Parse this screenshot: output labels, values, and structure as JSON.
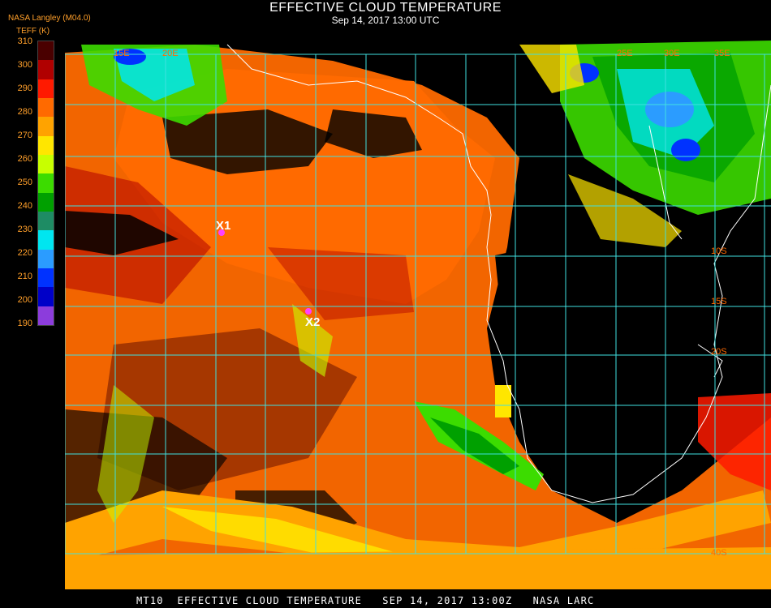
{
  "header": {
    "title": "EFFECTIVE CLOUD TEMPERATURE",
    "subtitle": "Sep 14, 2017 13:00 UTC",
    "org": "NASA Langley (M04.0)",
    "units": "TEFF (K)"
  },
  "legend": {
    "ticks": [
      "310",
      "300",
      "290",
      "280",
      "270",
      "260",
      "250",
      "240",
      "230",
      "220",
      "210",
      "200",
      "190"
    ],
    "colors": [
      "#4a0000",
      "#b00000",
      "#ff1a00",
      "#ff6a00",
      "#ffa300",
      "#ffe600",
      "#c8ff00",
      "#3cdc00",
      "#00a000",
      "#1e8c64",
      "#00e6f0",
      "#2b9cff",
      "#0032ff",
      "#0000c8",
      "#8c3cdc"
    ]
  },
  "map": {
    "grid_color": "#40e0e0",
    "coast_color": "#ffffff",
    "lat_labels": [
      "10S",
      "15S",
      "20S",
      "40S"
    ],
    "lon_labels": [
      "15E",
      "20E",
      "25E",
      "30E",
      "35E"
    ],
    "markers": [
      {
        "label": "X1",
        "color": "#ff40ff"
      },
      {
        "label": "X2",
        "color": "#ff40ff"
      }
    ]
  },
  "footer": "MT10  EFFECTIVE CLOUD TEMPERATURE   SEP 14, 2017 13:00Z   NASA LARC"
}
